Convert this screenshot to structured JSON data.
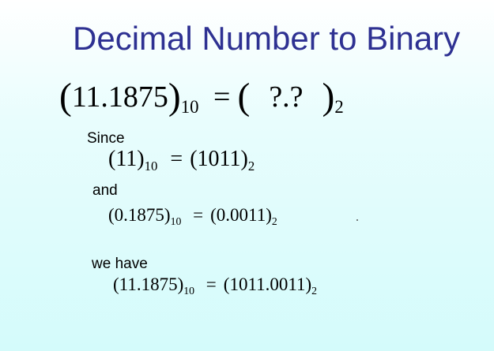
{
  "slide": {
    "title": "Decimal Number to Binary",
    "main_equation": {
      "decimal": "11.1875",
      "decimal_base": "10",
      "binary_unknown": "?.?",
      "binary_base": "2"
    },
    "since_label": "Since",
    "integer_part": {
      "decimal": "11",
      "decimal_base": "10",
      "binary": "1011",
      "binary_base": "2"
    },
    "and_label": "and",
    "fraction_part": {
      "decimal": "0.1875",
      "decimal_base": "10",
      "binary": "0.0011",
      "binary_base": "2"
    },
    "we_have_label": "we have",
    "result": {
      "decimal": "11.1875",
      "decimal_base": "10",
      "binary": "1011.0011",
      "binary_base": "2"
    }
  }
}
